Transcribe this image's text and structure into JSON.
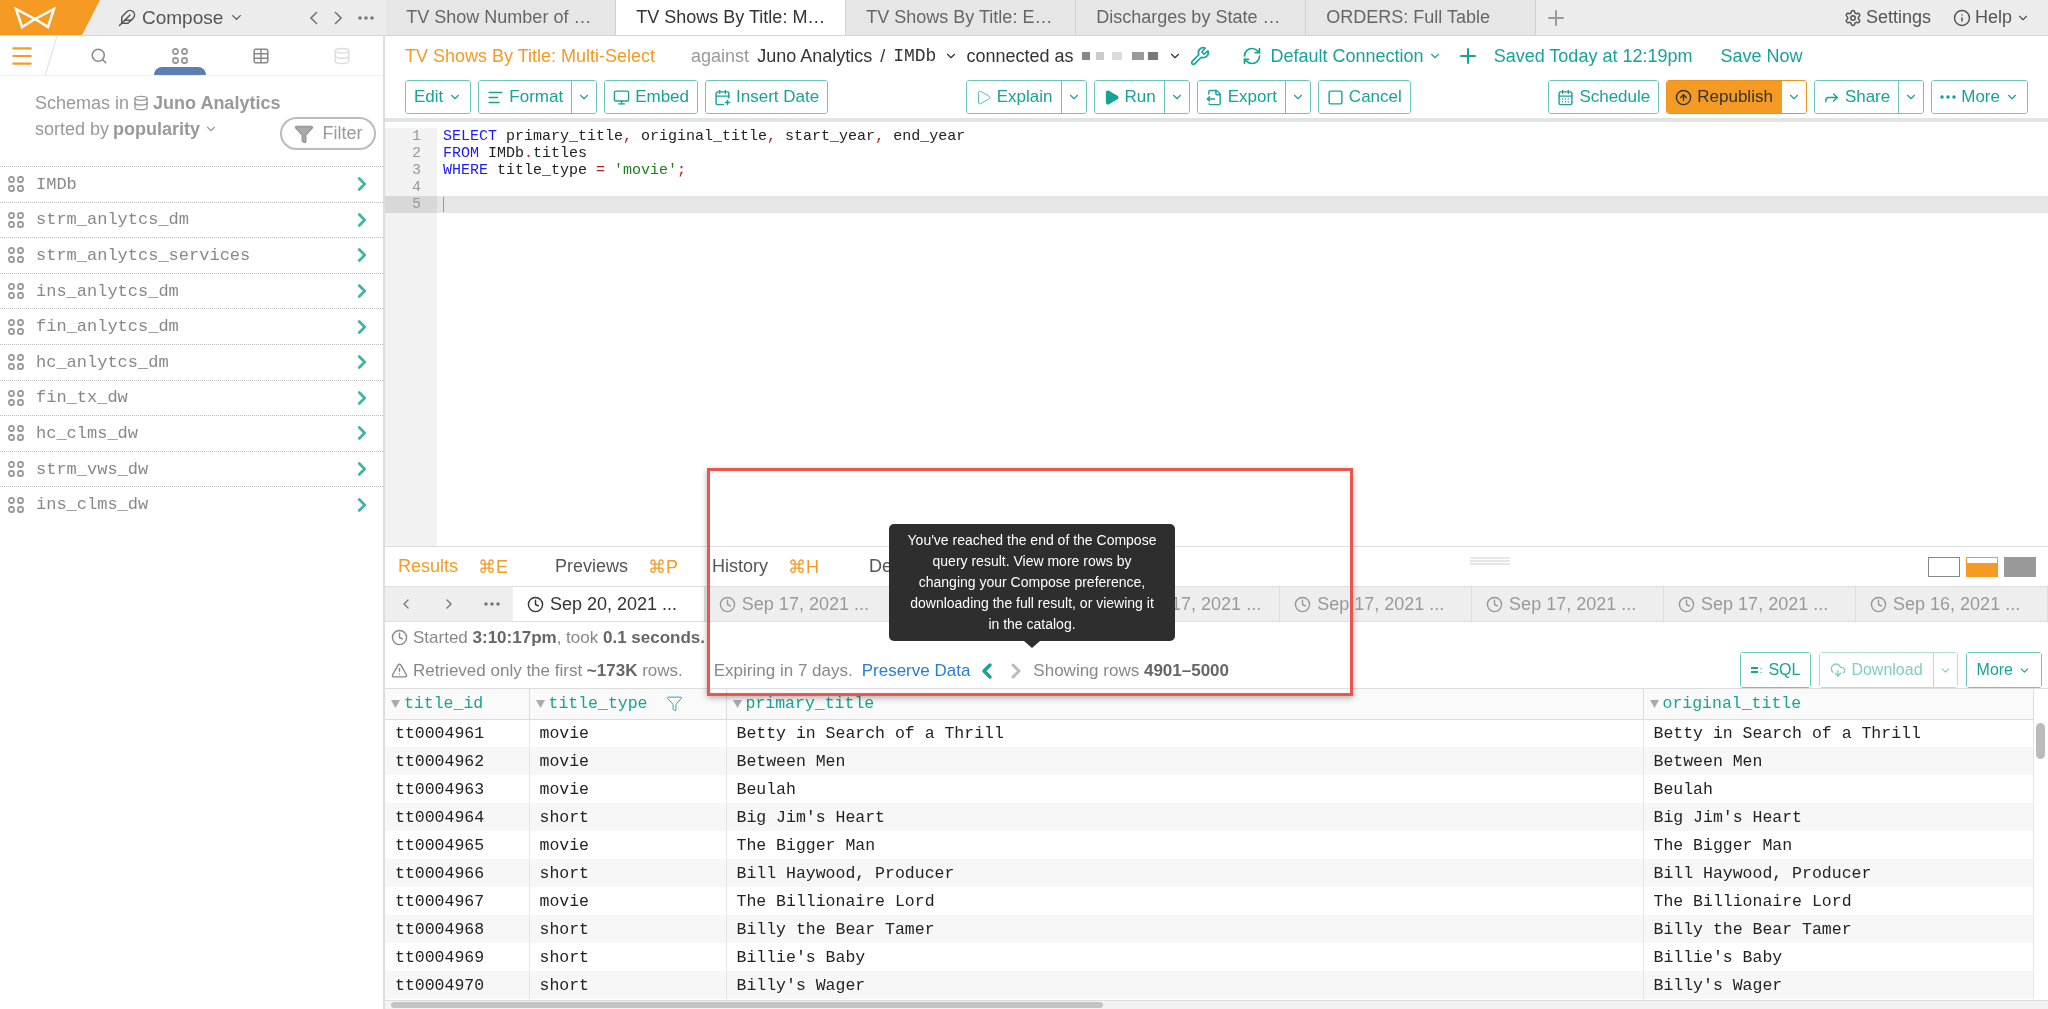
{
  "top_bar": {
    "app_menu": "Compose",
    "tabs": [
      {
        "label": "TV Show Number of …",
        "selected": false
      },
      {
        "label": "TV Shows By Title: M…",
        "selected": true
      },
      {
        "label": "TV Shows By Title: E…",
        "selected": false
      },
      {
        "label": "Discharges by State …",
        "selected": false
      },
      {
        "label": "ORDERS: Full Table",
        "selected": false
      }
    ],
    "settings": "Settings",
    "help": "Help"
  },
  "sidebar": {
    "tools": [
      {
        "kind": "search",
        "selected": false,
        "disabled": false
      },
      {
        "kind": "schemas",
        "selected": true,
        "disabled": false
      },
      {
        "kind": "tables",
        "selected": false,
        "disabled": false
      },
      {
        "kind": "database",
        "selected": false,
        "disabled": true
      }
    ],
    "heading_prefix": "Schemas in",
    "source": "Juno Analytics",
    "sort_prefix": "sorted by",
    "sort": "popularity",
    "filter": "Filter",
    "schemas": [
      "IMDb",
      "strm_anlytcs_dm",
      "strm_anlytcs_services",
      "ins_anlytcs_dm",
      "fin_anlytcs_dm",
      "hc_anlytcs_dm",
      "fin_tx_dw",
      "hc_clms_dw",
      "strm_vws_dw",
      "ins_clms_dw"
    ]
  },
  "query": {
    "title": "TV Shows By Title: Multi-Select",
    "against": "against",
    "source": "Juno Analytics",
    "separator": "/",
    "schema": "IMDb",
    "connected": "connected as",
    "connection": "Default Connection",
    "saved": "Saved Today at 12:19pm",
    "save_now": "Save Now"
  },
  "toolbar": {
    "left": [
      {
        "label": "Edit",
        "kind": "menu"
      },
      {
        "label": "Format",
        "kind": "split"
      },
      {
        "label": "Embed",
        "kind": "plain"
      },
      {
        "label": "Insert Date",
        "kind": "plain"
      }
    ],
    "center": [
      {
        "label": "Explain",
        "kind": "split"
      },
      {
        "label": "Run",
        "kind": "split"
      },
      {
        "label": "Export",
        "kind": "split"
      },
      {
        "label": "Cancel",
        "kind": "plain"
      }
    ],
    "right": [
      {
        "label": "Schedule",
        "kind": "plain"
      },
      {
        "label": "Republish",
        "kind": "primary-split"
      },
      {
        "label": "Share",
        "kind": "split"
      },
      {
        "label": "More",
        "kind": "menu"
      }
    ]
  },
  "editor": {
    "lines": [
      {
        "number": "1",
        "active": false,
        "tokens": [
          {
            "kind": "keyword",
            "text": "SELECT"
          },
          {
            "kind": "plain",
            "text": " primary_title"
          },
          {
            "kind": "punct",
            "text": ","
          },
          {
            "kind": "plain",
            "text": " original_title"
          },
          {
            "kind": "punct",
            "text": ","
          },
          {
            "kind": "plain",
            "text": " start_year"
          },
          {
            "kind": "punct",
            "text": ","
          },
          {
            "kind": "plain",
            "text": " end_year"
          }
        ]
      },
      {
        "number": "2",
        "active": false,
        "tokens": [
          {
            "kind": "keyword",
            "text": "FROM"
          },
          {
            "kind": "plain",
            "text": " IMDb"
          },
          {
            "kind": "punct",
            "text": "."
          },
          {
            "kind": "plain",
            "text": "titles"
          }
        ]
      },
      {
        "number": "3",
        "active": false,
        "tokens": [
          {
            "kind": "keyword",
            "text": "WHERE"
          },
          {
            "kind": "plain",
            "text": " title_type "
          },
          {
            "kind": "punct",
            "text": "="
          },
          {
            "kind": "string",
            "text": " 'movie'"
          },
          {
            "kind": "punct",
            "text": ";"
          }
        ]
      },
      {
        "number": "4",
        "active": false
      },
      {
        "number": "5",
        "active": true
      }
    ]
  },
  "results": {
    "tabs": [
      {
        "label": "Results",
        "shortcut": "⌘E",
        "selected": true
      },
      {
        "label": "Previews",
        "shortcut": "⌘P",
        "selected": false
      },
      {
        "label": "History",
        "shortcut": "⌘H",
        "selected": false
      },
      {
        "label": "De",
        "selected": false
      }
    ],
    "layouts": [
      {
        "kind": "outline",
        "selected": false
      },
      {
        "kind": "split",
        "selected": true
      },
      {
        "kind": "full",
        "selected": false
      }
    ],
    "runs": [
      {
        "label": "Sep 20, 2021 ...",
        "kind": "full",
        "selected": true
      },
      {
        "label": "Sep 17, 2021 ...",
        "kind": "full",
        "selected": false
      },
      {
        "label": "17, 2021 ...",
        "kind": "partial",
        "selected": false
      },
      {
        "label": "Sep 17, 2021 ...",
        "kind": "full",
        "selected": false
      },
      {
        "label": "Sep 17, 2021 ...",
        "kind": "full",
        "selected": false
      },
      {
        "label": "Sep 17, 2021 ...",
        "kind": "full",
        "selected": false
      },
      {
        "label": "Sep 16, 2021 ...",
        "kind": "full",
        "selected": false
      }
    ],
    "tooltip": "You've reached the end of the Compose query result. View more rows by changing your Compose preference, downloading the full result, or viewing it in the catalog.",
    "started": "Started **3:10:17pm**, took **0.1 seconds.**",
    "retrieved": "Retrieved only the first **~173K** rows.",
    "expiry": "Expiring in 7 days.",
    "preserve": "Preserve Data",
    "pager": {
      "prev_disabled": false,
      "next_disabled": true
    },
    "showing": "Showing rows **4901–5000**",
    "actions": [
      {
        "label": "SQL",
        "kind": "sql",
        "disabled": false
      },
      {
        "label": "Download",
        "kind": "download",
        "disabled": true
      },
      {
        "label": "More",
        "kind": "more",
        "disabled": false
      }
    ],
    "table": {
      "columns": [
        {
          "label": "title_id",
          "filter": false
        },
        {
          "label": "title_type",
          "filter": true
        },
        {
          "label": "primary_title",
          "filter": false
        },
        {
          "label": "original_title",
          "filter": false
        }
      ],
      "rows": [
        [
          "tt0004961",
          "movie",
          "Betty in Search of a Thrill",
          "Betty in Search of a Thrill"
        ],
        [
          "tt0004962",
          "movie",
          "Between Men",
          "Between Men"
        ],
        [
          "tt0004963",
          "movie",
          "Beulah",
          "Beulah"
        ],
        [
          "tt0004964",
          "short",
          "Big Jim's Heart",
          "Big Jim's Heart"
        ],
        [
          "tt0004965",
          "movie",
          "The Bigger Man",
          "The Bigger Man"
        ],
        [
          "tt0004966",
          "short",
          "Bill Haywood, Producer",
          "Bill Haywood, Producer"
        ],
        [
          "tt0004967",
          "movie",
          "The Billionaire Lord",
          "The Billionaire Lord"
        ],
        [
          "tt0004968",
          "short",
          "Billy the Bear Tamer",
          "Billy the Bear Tamer"
        ],
        [
          "tt0004969",
          "short",
          "Billie's Baby",
          "Billie's Baby"
        ],
        [
          "tt0004970",
          "short",
          "Billy's Wager",
          "Billy's Wager"
        ]
      ]
    }
  }
}
